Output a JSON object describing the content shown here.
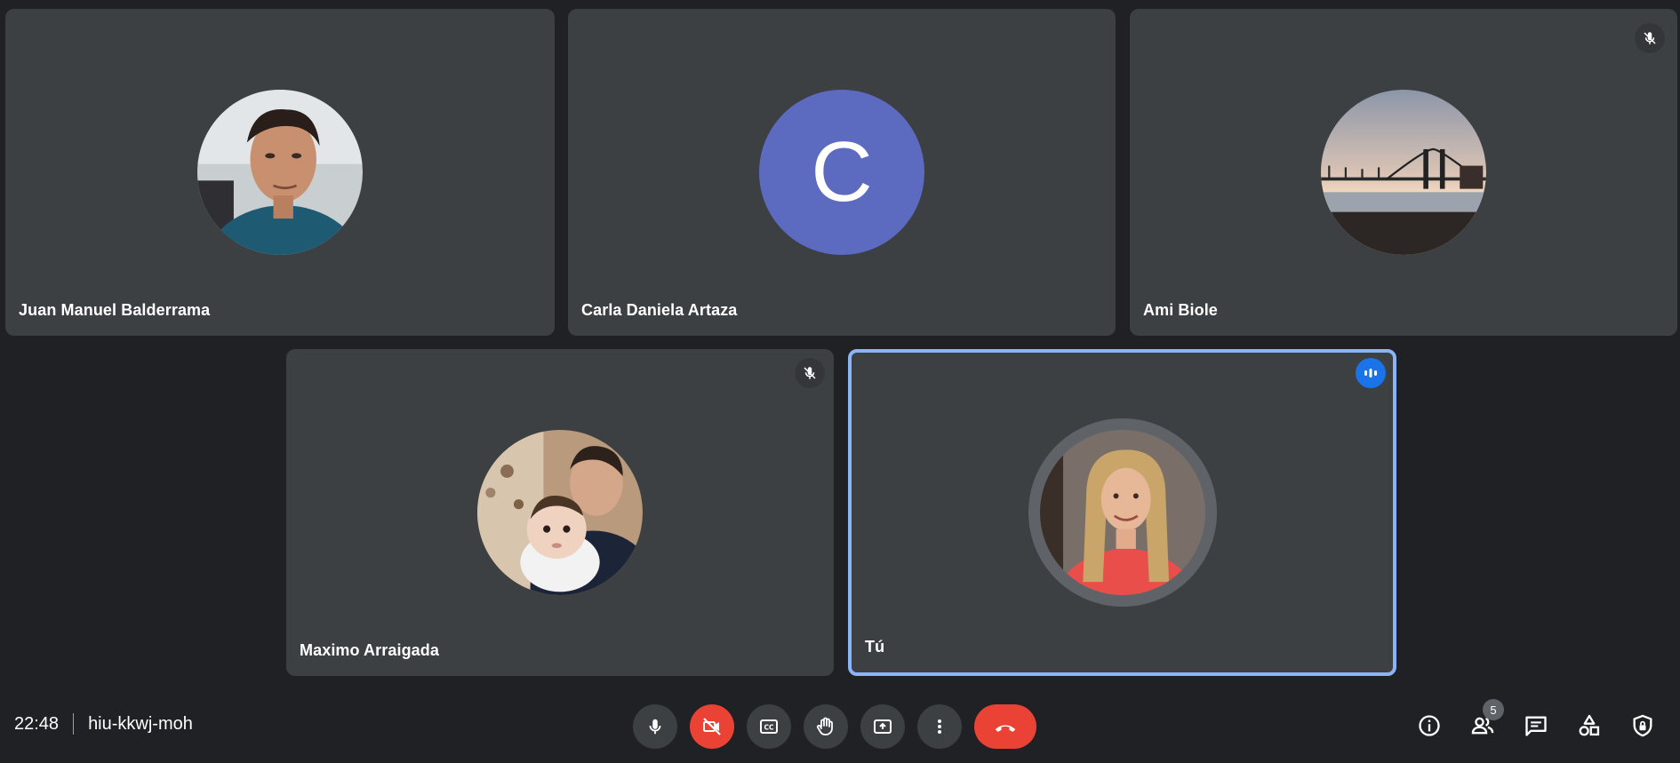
{
  "participants": [
    {
      "name": "Juan Manuel Balderrama",
      "avatar": "photo",
      "muted": false
    },
    {
      "name": "Carla Daniela Artaza",
      "avatar": "letter",
      "letter": "C",
      "avatar_color": "#5c6bc0",
      "muted": false
    },
    {
      "name": "Ami Biole",
      "avatar": "photo",
      "muted": true
    },
    {
      "name": "Maximo Arraigada",
      "avatar": "photo",
      "muted": true
    },
    {
      "name": "Tú",
      "avatar": "photo",
      "muted": false,
      "speaking": true,
      "self": true
    }
  ],
  "meeting": {
    "time": "22:48",
    "code": "hiu-kkwj-moh"
  },
  "controls": [
    {
      "name": "microphone-icon",
      "state": "on"
    },
    {
      "name": "camera-off-icon",
      "state": "off"
    },
    {
      "name": "closed-captions-icon"
    },
    {
      "name": "raise-hand-icon"
    },
    {
      "name": "present-screen-icon"
    },
    {
      "name": "more-options-icon"
    },
    {
      "name": "end-call-icon"
    }
  ],
  "side_panel": {
    "people_count": "5",
    "icons": [
      "info-icon",
      "people-icon",
      "chat-icon",
      "activities-icon",
      "host-controls-icon"
    ]
  },
  "colors": {
    "background": "#202124",
    "tile": "#3c4043",
    "active_border": "#8ab4f8",
    "danger": "#ea4335",
    "speaking": "#1a73e8"
  }
}
